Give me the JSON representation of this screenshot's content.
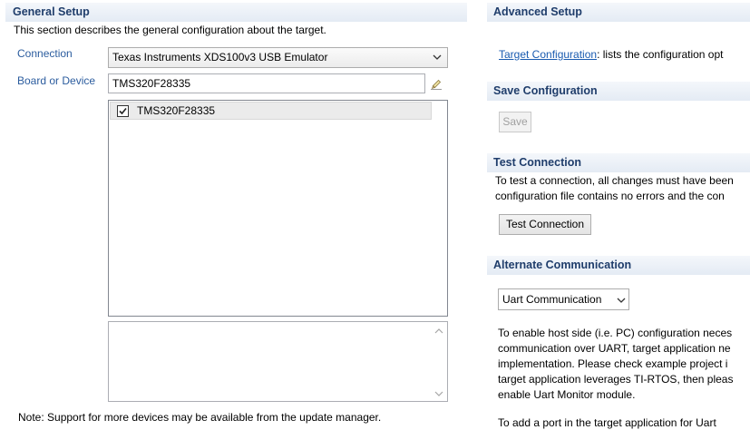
{
  "theme": {
    "header_text": "#1f3d6b",
    "label_text": "#2b5c9e",
    "link_text": "#1a5bb0",
    "band_top": "#f4f7fb",
    "band_bottom": "#e4ebf4"
  },
  "general_setup": {
    "title": "General Setup",
    "description": "This section describes the general configuration about the target.",
    "connection": {
      "label": "Connection",
      "selected": "Texas Instruments XDS100v3 USB Emulator",
      "icon": "chevron-down-icon"
    },
    "board_or_device": {
      "label": "Board or Device",
      "filter_value": "TMS320F28335",
      "clear_icon": "eraser-icon",
      "items": [
        {
          "label": "TMS320F28335",
          "checked": true
        }
      ]
    },
    "note": "Note: Support for more devices may be available from the update manager."
  },
  "advanced_setup": {
    "title": "Advanced Setup",
    "link_label": "Target Configuration",
    "link_description": ": lists the configuration opt"
  },
  "save_configuration": {
    "title": "Save Configuration",
    "save_label": "Save",
    "save_enabled": false
  },
  "test_connection": {
    "title": "Test Connection",
    "lines": [
      "To test a connection, all changes must have been",
      "configuration file contains no errors and the con"
    ],
    "button_label": "Test Connection"
  },
  "alternate_communication": {
    "title": "Alternate Communication",
    "selected": "Uart Communication",
    "paragraph_lines": [
      "To enable host side (i.e. PC) configuration neces",
      "communication over UART, target application ne",
      "implementation. Please check example project i",
      "target application leverages TI-RTOS, then pleas",
      "enable Uart Monitor module."
    ],
    "second_paragraph": "To add a port in the target application for Uart"
  }
}
